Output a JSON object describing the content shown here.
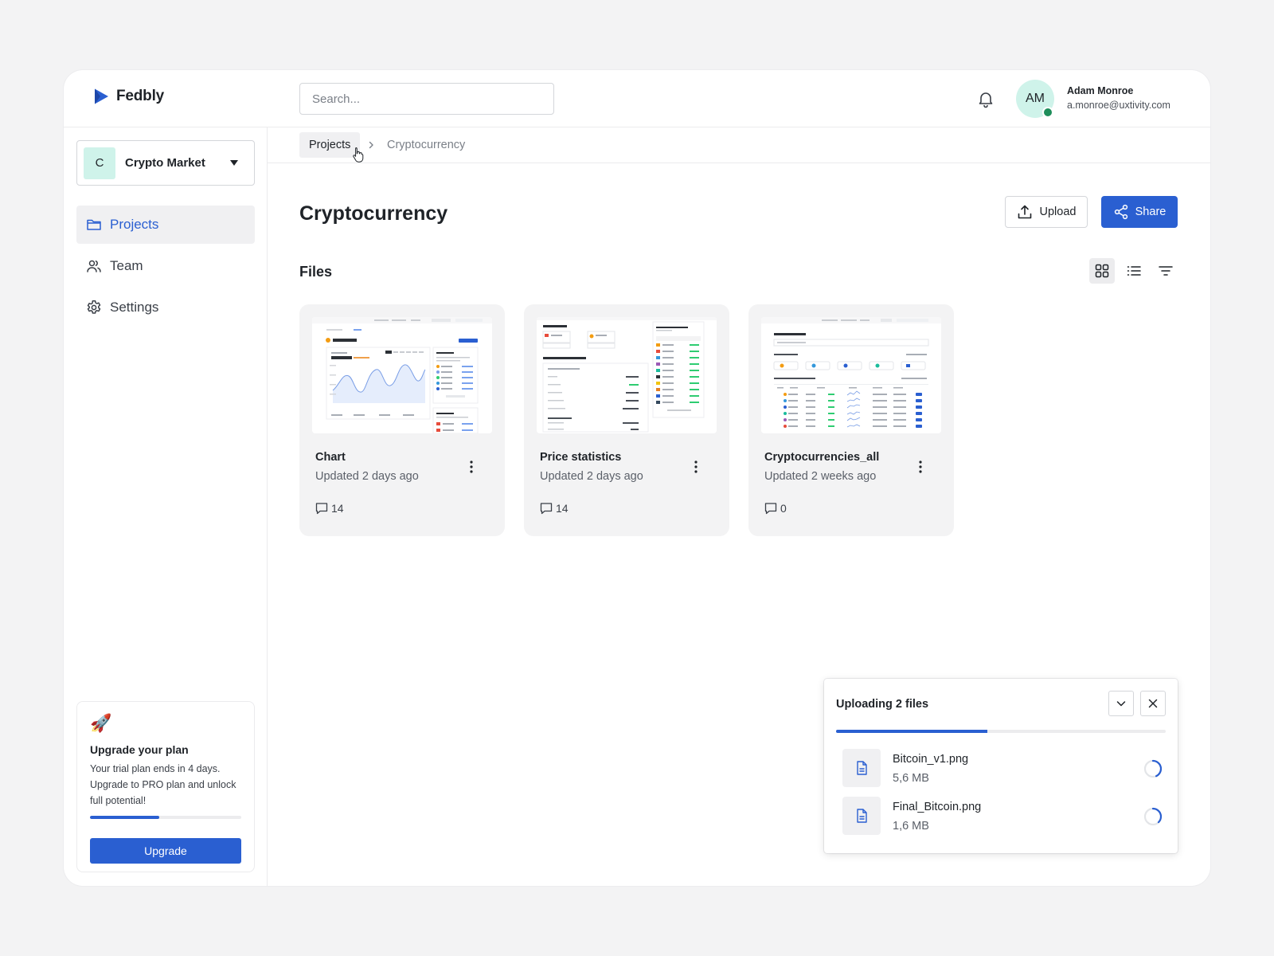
{
  "app": {
    "name": "Fedbly",
    "brand_color": "#2a5fd1"
  },
  "header": {
    "search_placeholder": "Search...",
    "notifications_icon": "bell-icon",
    "user": {
      "initials": "AM",
      "name": "Adam Monroe",
      "email": "a.monroe@uxtivity.com",
      "status": "online"
    }
  },
  "sidebar": {
    "workspace": {
      "initial": "C",
      "name": "Crypto Market"
    },
    "items": [
      {
        "label": "Projects",
        "icon": "folder-icon",
        "active": true
      },
      {
        "label": "Team",
        "icon": "users-icon",
        "active": false
      },
      {
        "label": "Settings",
        "icon": "gear-icon",
        "active": false
      }
    ],
    "upgrade": {
      "emoji": "🚀",
      "title": "Upgrade your plan",
      "text": "Your trial plan ends in 4 days. Upgrade to PRO plan and unlock full potential!",
      "progress": 0.46,
      "button": "Upgrade"
    }
  },
  "breadcrumb": {
    "parent": "Projects",
    "current": "Cryptocurrency"
  },
  "main": {
    "title": "Cryptocurrency",
    "upload_label": "Upload",
    "share_label": "Share",
    "files_title": "Files",
    "view_modes": [
      "grid-view-icon",
      "list-view-icon",
      "filter-icon"
    ],
    "active_view": "grid"
  },
  "files": [
    {
      "title": "Chart",
      "updated": "Updated 2 days ago",
      "comments": "14"
    },
    {
      "title": "Price statistics",
      "updated": "Updated 2 days ago",
      "comments": "14"
    },
    {
      "title": "Cryptocurrencies_all",
      "updated": "Updated 2 weeks ago",
      "comments": "0"
    }
  ],
  "uploads": {
    "title": "Uploading 2 files",
    "progress": 0.46,
    "items": [
      {
        "name": "Bitcoin_v1.png",
        "size": "5,6 MB"
      },
      {
        "name": "Final_Bitcoin.png",
        "size": "1,6 MB"
      }
    ]
  }
}
